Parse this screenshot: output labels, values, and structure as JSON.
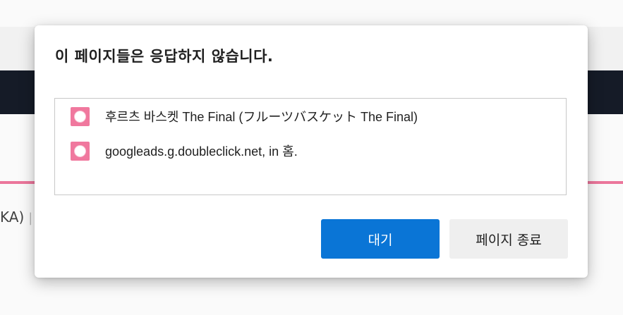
{
  "background": {
    "partial_text": "KA)",
    "separator": "|"
  },
  "dialog": {
    "title": "이 페이지들은 응답하지 않습니다.",
    "items": [
      {
        "label": "후르츠 바스켓 The Final (フルーツバスケット The Final)"
      },
      {
        "label": "googleads.g.doubleclick.net, in 홈."
      }
    ],
    "wait_button": "대기",
    "exit_button": "페이지 종료"
  },
  "colors": {
    "accent_pink": "#f0789e",
    "primary_button": "#0a75d6",
    "nav_dark": "#161c28"
  }
}
